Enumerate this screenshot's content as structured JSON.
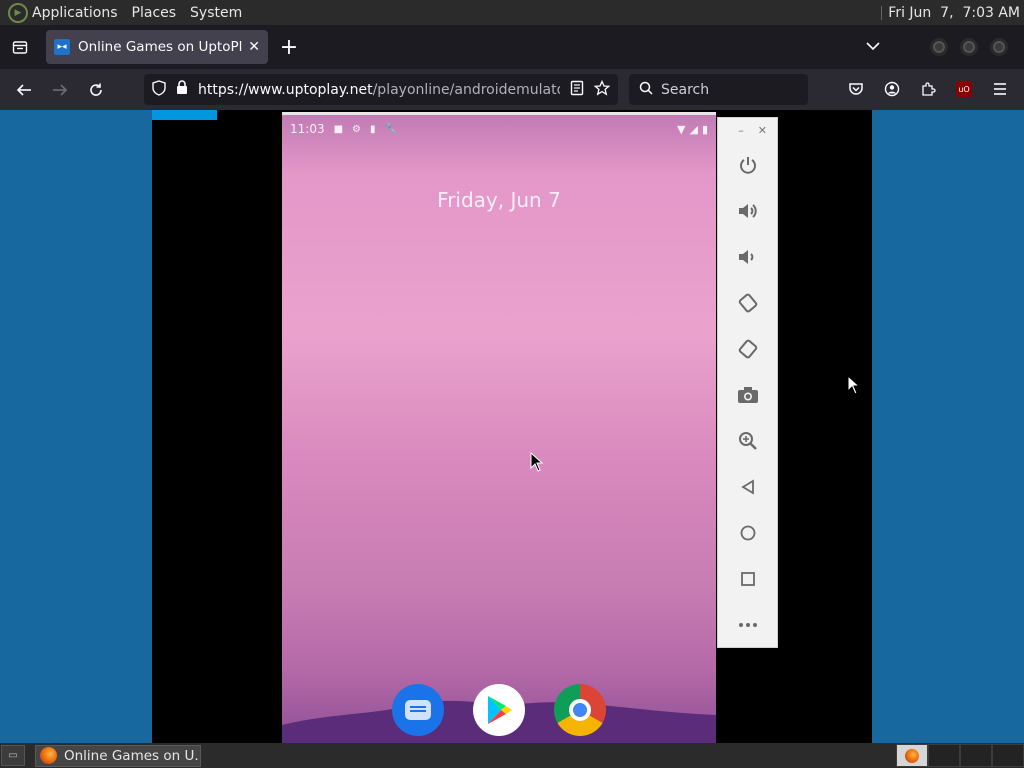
{
  "top_panel": {
    "menus": [
      "Applications",
      "Places",
      "System"
    ],
    "clock": "Fri Jun  7,  7:03 AM"
  },
  "browser": {
    "tab_title": "Online Games on UptoPlay",
    "new_tab": "+",
    "url_host": "https://www.uptoplay.net",
    "url_path": "/playonline/androidemulator.p",
    "search_placeholder": "Search",
    "ublock_badge": "uO"
  },
  "emulator": {
    "status_time": "11:03",
    "lock_date": "Friday, Jun 7",
    "dock_apps": [
      "Messages",
      "Play Store",
      "Chrome"
    ],
    "controls": [
      "power",
      "volume-up",
      "volume-down",
      "rotate-left",
      "rotate-right",
      "screenshot",
      "zoom",
      "back",
      "home",
      "overview",
      "more"
    ]
  },
  "taskbar": {
    "task_label": "Online Games on U..."
  },
  "colors": {
    "page_bg": "#16689f",
    "progress": "#0096e0",
    "tab_active": "#42414d"
  }
}
